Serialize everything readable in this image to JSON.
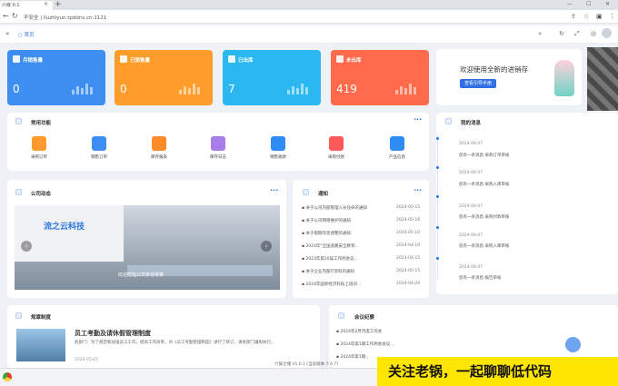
{
  "browser": {
    "tab_title": "六级 0.1",
    "address": "不安全 | liuzhiyun.tpddns.cn:1121"
  },
  "app": {
    "home": "首页"
  },
  "stats": [
    {
      "label": "月销售量",
      "value": "0",
      "color": "#3d8ef0"
    },
    {
      "label": "已销售量",
      "value": "0",
      "color": "#ff9d2a"
    },
    {
      "label": "已出库",
      "value": "7",
      "color": "#2bb8f0"
    },
    {
      "label": "未出库",
      "value": "419",
      "color": "#ff6a4a"
    }
  ],
  "banner": {
    "title": "欢迎使用全新的进销存",
    "button": "查看引导手册"
  },
  "functions": {
    "title": "常用功能",
    "items": [
      {
        "label": "采购订单",
        "color": "#ff9a2e"
      },
      {
        "label": "销售订单",
        "color": "#3c8ef0"
      },
      {
        "label": "库存报表",
        "color": "#ff8a2a"
      },
      {
        "label": "库存日志",
        "color": "#a77ee8"
      },
      {
        "label": "销售收款",
        "color": "#2e8df5"
      },
      {
        "label": "采购付款",
        "color": "#ff5a5a"
      },
      {
        "label": "产品信息",
        "color": "#2e8df5"
      }
    ]
  },
  "messages": {
    "title": "我的消息",
    "items": [
      {
        "date": "2024-06-07",
        "text": "您有一条消息:采购订单审核"
      },
      {
        "date": "2024-06-07",
        "text": "您有一条消息:采购入库审核"
      },
      {
        "date": "2024-06-07",
        "text": "您有一条消息:采购付款审核"
      },
      {
        "date": "2024-06-07",
        "text": "您有一条消息:采购入库审核"
      },
      {
        "date": "2024-06-07",
        "text": "您有一条消息:报告审核"
      }
    ]
  },
  "company": {
    "title": "公司动态",
    "caption": "欢迎莅临公司参观考察",
    "sign": "流之云科技"
  },
  "notices": {
    "title": "通知",
    "items": [
      {
        "text": "关于公司内部管理人员任命的通知",
        "date": "2024-05-15"
      },
      {
        "text": "关于公司网络维护的通知",
        "date": "2024-05-16"
      },
      {
        "text": "关于假期作息调整的通知",
        "date": "2024-05-10"
      },
      {
        "text": "2024年\"全国道路安全教育...",
        "date": "2024-04-10"
      },
      {
        "text": "2023年第20届工作例会议...",
        "date": "2023-04-15"
      },
      {
        "text": "关于企业内部IT资料的通知",
        "date": "2024-05-15"
      },
      {
        "text": "2024年国际经济科技上培训...",
        "date": "2024-04-29"
      }
    ]
  },
  "rules": {
    "title": "规章制度",
    "article_title": "员工考勤及请休假管理制度",
    "article_text": "各部门：为了规范和加强员工工作。提高工作效率。对《员工考勤管理制度》进行了修订、请各部门遵照执行。",
    "article_date": "2024-05-07"
  },
  "meetings": {
    "title": "会议纪要",
    "items": [
      "2024年2月月度工作会",
      "2024年第1期工作例会会议...",
      "2024年第1期..."
    ]
  },
  "footer": {
    "version": "六鼓仓储 V1.0.1 [当前版本:7.0.7]"
  },
  "ad": {
    "text": "关注老锅，一起聊聊低代码"
  }
}
